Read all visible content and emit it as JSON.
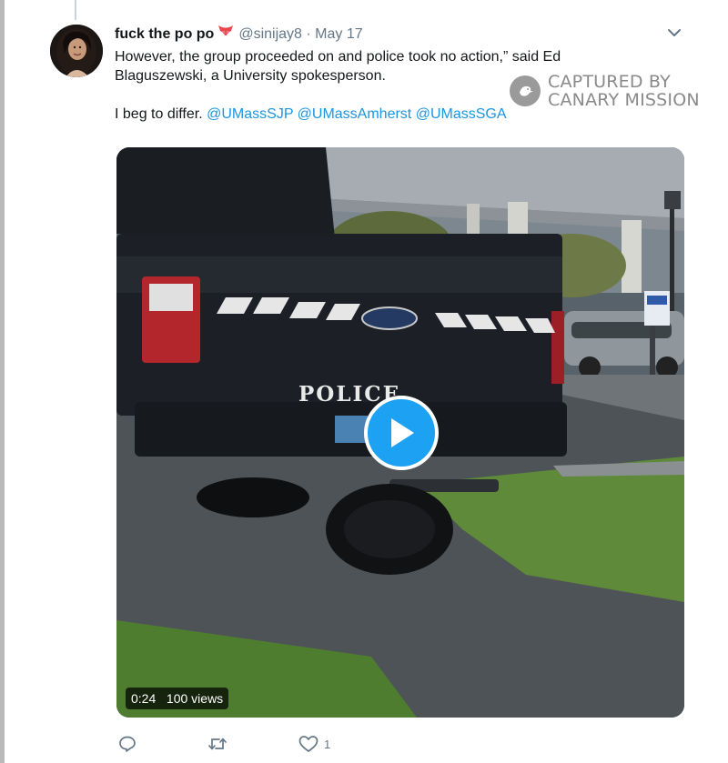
{
  "tweet": {
    "display_name": "fuck the po po",
    "handle": "@sinijay8",
    "separator": "·",
    "date": "May 17",
    "text_line1": "However, the group proceeded on and police took no action,” said Ed",
    "text_line2": "Blaguszewski, a University spokesperson.",
    "reply_prefix": "I beg to differ.",
    "mentions": [
      "@UMassSJP",
      "@UMassAmherst",
      "@UMassSGA"
    ],
    "emoji_icon": "tongue-emoji-icon"
  },
  "watermark": {
    "line1": "CAPTURED BY",
    "line2": "CANARY MISSION"
  },
  "video": {
    "truck_lettering": "POLICE",
    "duration": "0:24",
    "views": "100 views"
  },
  "actions": {
    "reply_icon": "reply-icon",
    "retweet_icon": "retweet-icon",
    "like_icon": "heart-icon",
    "like_count": "1"
  },
  "colors": {
    "link": "#1b95e0",
    "play_button": "#1da1f2",
    "muted_text": "#657786"
  }
}
